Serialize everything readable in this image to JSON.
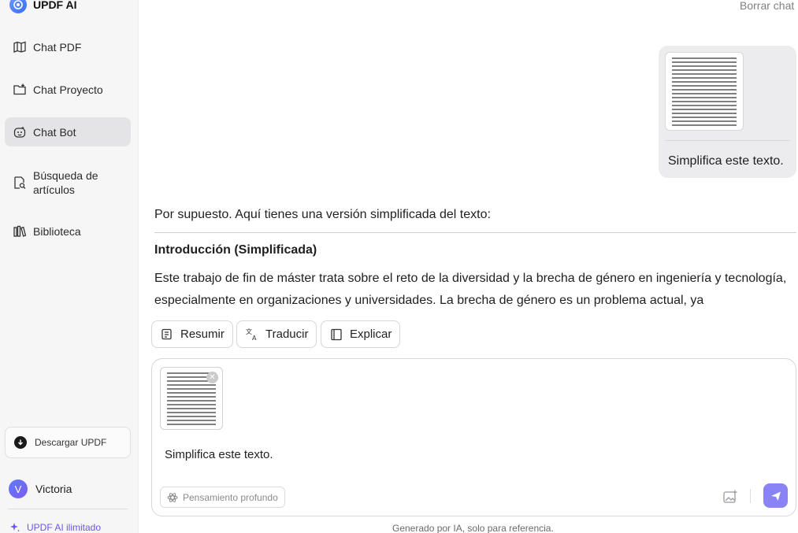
{
  "app": {
    "brand": "UPDF AI"
  },
  "sidebar": {
    "items": [
      {
        "label": "Chat PDF",
        "icon": "map-book-icon"
      },
      {
        "label": "Chat Proyecto",
        "icon": "folder-plus-icon"
      },
      {
        "label": "Chat Bot",
        "icon": "bot-face-icon",
        "active": true
      },
      {
        "label": "Búsqueda de artículos",
        "icon": "doc-search-icon"
      },
      {
        "label": "Biblioteca",
        "icon": "library-icon"
      }
    ],
    "download_label": "Descargar UPDF",
    "user": {
      "initial": "V",
      "name": "Victoria"
    },
    "unlimited_label": "UPDF AI ilimitado"
  },
  "header": {
    "clear_chat": "Borrar chat"
  },
  "chat": {
    "user_message": "Simplifica este texto.",
    "ai_intro": "Por supuesto. Aquí tienes una versión simplificada del texto:",
    "ai_heading": "Introducción (Simplificada)",
    "ai_body": "Este trabajo de fin de máster trata sobre el reto de la diversidad y la brecha de género en ingeniería y tecnología, especialmente en organizaciones y universidades. La brecha de género es un problema actual, ya"
  },
  "actions": {
    "summarize": "Resumir",
    "translate": "Traducir",
    "explain": "Explicar"
  },
  "composer": {
    "text": "Simplifica este texto.",
    "deep_think_label": "Pensamiento profundo"
  },
  "footer": {
    "note": "Generado por IA, solo para referencia."
  },
  "colors": {
    "accent": "#8a83f5",
    "brand_purple": "#6c55e8",
    "active_bg": "#e4e4e7"
  }
}
